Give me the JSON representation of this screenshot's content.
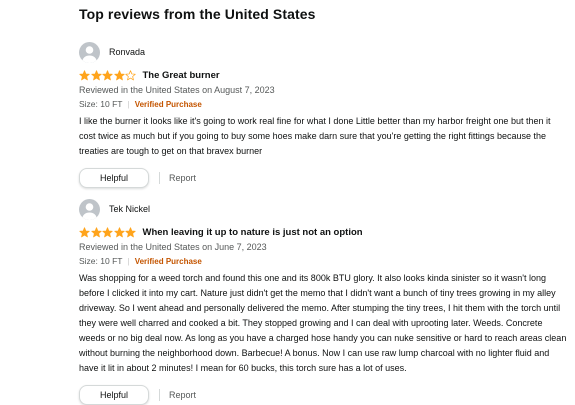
{
  "section_heading": "Top reviews from the United States",
  "colors": {
    "star": "#FFA41C",
    "verified": "#C45500",
    "avatar": "#BFC4C9"
  },
  "reviews": [
    {
      "reviewer": "Ronvada",
      "rating": 4,
      "title": "The Great burner",
      "meta": "Reviewed in the United States on August 7, 2023",
      "variant": "Size: 10 FT",
      "verified": "Verified Purchase",
      "body": "I like the burner it looks like it's going to work real fine for what I done Little better than my harbor freight one but then it cost twice as much but if you going to buy some hoes make darn sure that you're getting the right fittings because the treaties are tough to get on that bravex burner",
      "helpful_label": "Helpful",
      "report_label": "Report"
    },
    {
      "reviewer": "Tek Nickel",
      "rating": 5,
      "title": "When leaving it up to nature is just not an option",
      "meta": "Reviewed in the United States on June 7, 2023",
      "variant": "Size: 10 FT",
      "verified": "Verified Purchase",
      "body": "Was shopping for a weed torch and found this one and its 800k BTU glory. It also looks kinda sinister so it wasn't long before I clicked it into my cart. Nature just didn't get the memo that I didn't want a bunch of tiny trees growing in my alley driveway. So I went ahead and personally delivered the memo. After stumping the tiny trees, I hit them with the torch until they were well charred and cooked a bit. They stopped growing and I can deal with uprooting later. Weeds. Concrete weeds or no big deal now. As long as you have a charged hose handy you can nuke sensitive or hard to reach areas clean without burning the neighborhood down. Barbecue! A bonus. Now I can use raw lump charcoal with no lighter fluid and have it lit in about 2 minutes! I mean for 60 bucks, this torch sure has a lot of uses.",
      "helpful_label": "Helpful",
      "report_label": "Report"
    }
  ]
}
